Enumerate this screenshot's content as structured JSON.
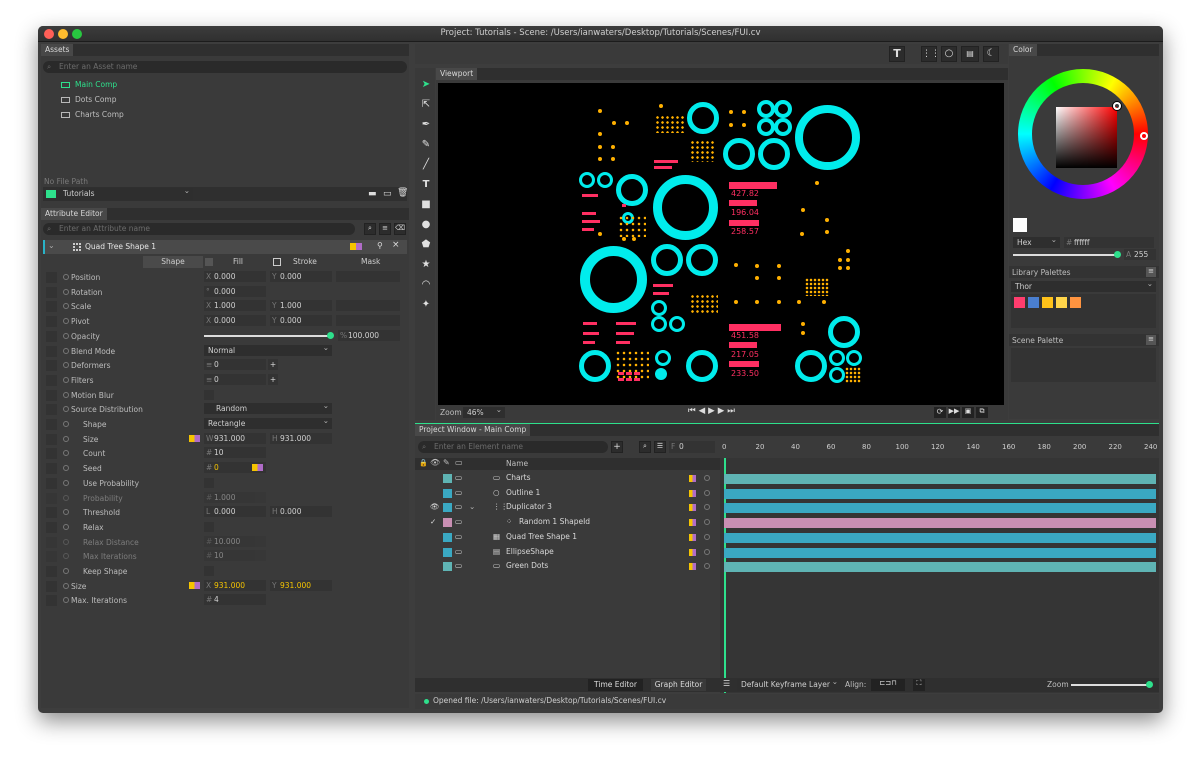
{
  "window": {
    "title": "Project: Tutorials - Scene: /Users/ianwaters/Desktop/Tutorials/Scenes/FUI.cv"
  },
  "assets": {
    "tab": "Assets",
    "search_placeholder": "Enter an Asset name",
    "items": [
      {
        "label": "Main Comp",
        "active": true
      },
      {
        "label": "Dots Comp"
      },
      {
        "label": "Charts Comp"
      }
    ],
    "file_path": "No File Path",
    "project": "Tutorials"
  },
  "attributes": {
    "tab": "Attribute Editor",
    "search_placeholder": "Enter an Attribute name",
    "layer": "Quad Tree Shape 1",
    "columns": [
      "Shape",
      "Fill",
      "Stroke",
      "Mask"
    ],
    "position": {
      "label": "Position",
      "x": "0.000",
      "y": "0.000"
    },
    "rotation": {
      "label": "Rotation",
      "value": "0.000"
    },
    "scale": {
      "label": "Scale",
      "x": "1.000",
      "y": "1.000"
    },
    "pivot": {
      "label": "Pivot",
      "x": "0.000",
      "y": "0.000"
    },
    "opacity": {
      "label": "Opacity",
      "value": "100.000",
      "level": 1.0
    },
    "blend_mode": {
      "label": "Blend Mode",
      "value": "Normal"
    },
    "deformers": {
      "label": "Deformers",
      "value": "0"
    },
    "filters": {
      "label": "Filters",
      "value": "0"
    },
    "motion_blur": {
      "label": "Motion Blur"
    },
    "source_distribution": {
      "label": "Source Distribution",
      "value": "Random"
    },
    "shape": {
      "label": "Shape",
      "value": "Rectangle"
    },
    "size": {
      "label": "Size",
      "w": "931.000",
      "h": "931.000"
    },
    "count": {
      "label": "Count",
      "value": "10"
    },
    "seed": {
      "label": "Seed",
      "value": "0"
    },
    "use_probability": {
      "label": "Use Probability"
    },
    "probability": {
      "label": "Probability",
      "value": "1.000"
    },
    "threshold": {
      "label": "Threshold",
      "l": "0.000",
      "h": "0.000"
    },
    "relax": {
      "label": "Relax"
    },
    "relax_distance": {
      "label": "Relax Distance",
      "value": "10.000"
    },
    "max_iterations": {
      "label": "Max Iterations",
      "value": "10"
    },
    "keep_shape": {
      "label": "Keep Shape"
    },
    "size2": {
      "label": "Size",
      "x": "931.000",
      "y": "931.000"
    },
    "max_iterations2": {
      "label": "Max. Iterations",
      "value": "4"
    }
  },
  "viewport": {
    "tab": "Viewport",
    "zoom_label": "Zoom",
    "zoom_value": "46%",
    "values": [
      "427.82",
      "196.04",
      "258.57",
      "451.58",
      "217.05",
      "233.50"
    ]
  },
  "color": {
    "tab": "Color",
    "format": "Hex",
    "hex": "ffffff",
    "alpha_label": "A",
    "alpha": "255",
    "alpha_level": 1.0,
    "library_palettes": "Library Palettes",
    "palette_name": "Thor",
    "swatches": [
      "#ff3d6e",
      "#4a7fd0",
      "#ffc21a",
      "#ffd54a",
      "#ff9440"
    ],
    "scene_palette": "Scene Palette"
  },
  "project_window": {
    "tab": "Project Window - Main Comp",
    "search_placeholder": "Enter an Element name",
    "frame": "0",
    "name_header": "Name",
    "ticks": [
      "0",
      "20",
      "40",
      "60",
      "80",
      "100",
      "120",
      "140",
      "160",
      "180",
      "200",
      "220",
      "240"
    ],
    "layers": [
      {
        "name": "Charts",
        "color": "#5fb4b4"
      },
      {
        "name": "Outline 1",
        "color": "#3aa8c2"
      },
      {
        "name": "Duplicator 3",
        "color": "#3aa8c2"
      },
      {
        "name": "Random 1 ShapeId",
        "color": "#c98fb3"
      },
      {
        "name": "Quad Tree Shape 1",
        "color": "#3aa8c2"
      },
      {
        "name": "EllipseShape",
        "color": "#3aa8c2"
      },
      {
        "name": "Green Dots",
        "color": "#5fb4b4"
      }
    ],
    "time_editor": "Time Editor",
    "graph_editor": "Graph Editor",
    "keyframe_layer": "Default Keyframe Layer",
    "align_label": "Align:",
    "zoom_label": "Zoom"
  },
  "status": {
    "text": "Opened file: /Users/ianwaters/Desktop/Tutorials/Scenes/FUI.cv"
  }
}
